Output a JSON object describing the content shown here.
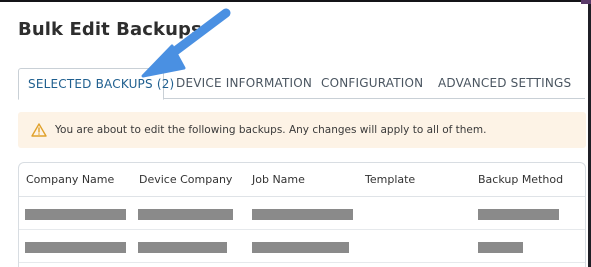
{
  "dialog": {
    "title": "Bulk Edit Backups"
  },
  "tabs": [
    {
      "label": "SELECTED BACKUPS (2)",
      "active": true
    },
    {
      "label": "DEVICE INFORMATION",
      "active": false
    },
    {
      "label": "CONFIGURATION",
      "active": false
    },
    {
      "label": "ADVANCED SETTINGS",
      "active": false
    }
  ],
  "notice": {
    "icon": "warning-triangle-icon",
    "text": "You are about to edit the following backups. Any changes will apply to all of them.",
    "color": "#e0a12b"
  },
  "table": {
    "columns": [
      "Company Name",
      "Device Company",
      "Job Name",
      "Template",
      "Backup Method"
    ]
  },
  "annotation": {
    "icon": "pointer-arrow-icon",
    "color": "#4a90e2"
  }
}
